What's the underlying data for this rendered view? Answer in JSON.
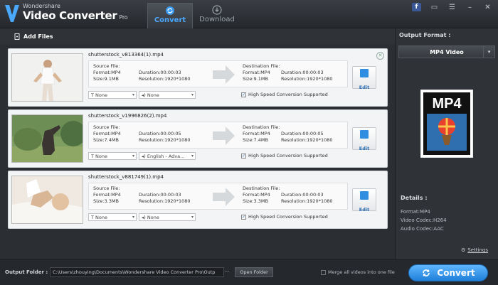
{
  "app": {
    "brand_small": "Wondershare",
    "brand_title": "Video Converter",
    "brand_pro": "Pro"
  },
  "tabs": [
    {
      "label": "Convert",
      "icon": "convert-icon",
      "active": true
    },
    {
      "label": "Download",
      "icon": "download-icon",
      "active": false
    }
  ],
  "window_controls": {
    "facebook": "f"
  },
  "toolbar": {
    "add_files": "Add Files"
  },
  "items": [
    {
      "filename": "shutterstock_v813364(1).mp4",
      "source_label": "Source File:",
      "source_format": "Format:MP4",
      "source_duration": "Duration:00:00:03",
      "source_size": "Size:9.1MB",
      "source_resolution": "Resolution:1920*1080",
      "dest_label": "Destination File:",
      "dest_format": "Format:MP4",
      "dest_duration": "Duration:00:00:03",
      "dest_size": "Size:9.1MB",
      "dest_resolution": "Resolution:1920*1080",
      "subtitle": "None",
      "audio": "None",
      "high_speed": "High Speed Conversion Supported",
      "edit": "Edit"
    },
    {
      "filename": "shutterstock_v1996826(2).mp4",
      "source_label": "Source File:",
      "source_format": "Format:MP4",
      "source_duration": "Duration:00:00:05",
      "source_size": "Size:7.4MB",
      "source_resolution": "Resolution:1920*1080",
      "dest_label": "Destination File:",
      "dest_format": "Format:MP4",
      "dest_duration": "Duration:00:00:05",
      "dest_size": "Size:7.4MB",
      "dest_resolution": "Resolution:1920*1080",
      "subtitle": "None",
      "audio": "English - Adva...",
      "high_speed": "High Speed Conversion Supported",
      "edit": "Edit"
    },
    {
      "filename": "shutterstock_v881749(1).mp4",
      "source_label": "Source File:",
      "source_format": "Format:MP4",
      "source_duration": "Duration:00:00:03",
      "source_size": "Size:3.3MB",
      "source_resolution": "Resolution:1920*1080",
      "dest_label": "Destination File:",
      "dest_format": "Format:MP4",
      "dest_duration": "Duration:00:00:03",
      "dest_size": "Size:3.3MB",
      "dest_resolution": "Resolution:1920*1080",
      "subtitle": "None",
      "audio": "None",
      "high_speed": "High Speed Conversion Supported",
      "edit": "Edit"
    }
  ],
  "output_panel": {
    "label": "Output Format :",
    "selected": "MP4 Video",
    "badge": "MP4",
    "details_label": "Details :",
    "details": [
      "Format:MP4",
      "Video Codec:H264",
      "Audio Codec:AAC"
    ],
    "settings": "Settings"
  },
  "footer": {
    "output_folder_label": "Output Folder :",
    "path": "C:\\Users\\zhouying\\Documents\\Wondershare Video Converter Pro\\Outp",
    "browse": "···",
    "open_folder": "Open Folder",
    "merge": "Merge all videos into one file",
    "convert": "Convert"
  },
  "colors": {
    "accent": "#2f8ee0",
    "background": "#2b2e33",
    "item_bg": "#f3f4f5"
  }
}
